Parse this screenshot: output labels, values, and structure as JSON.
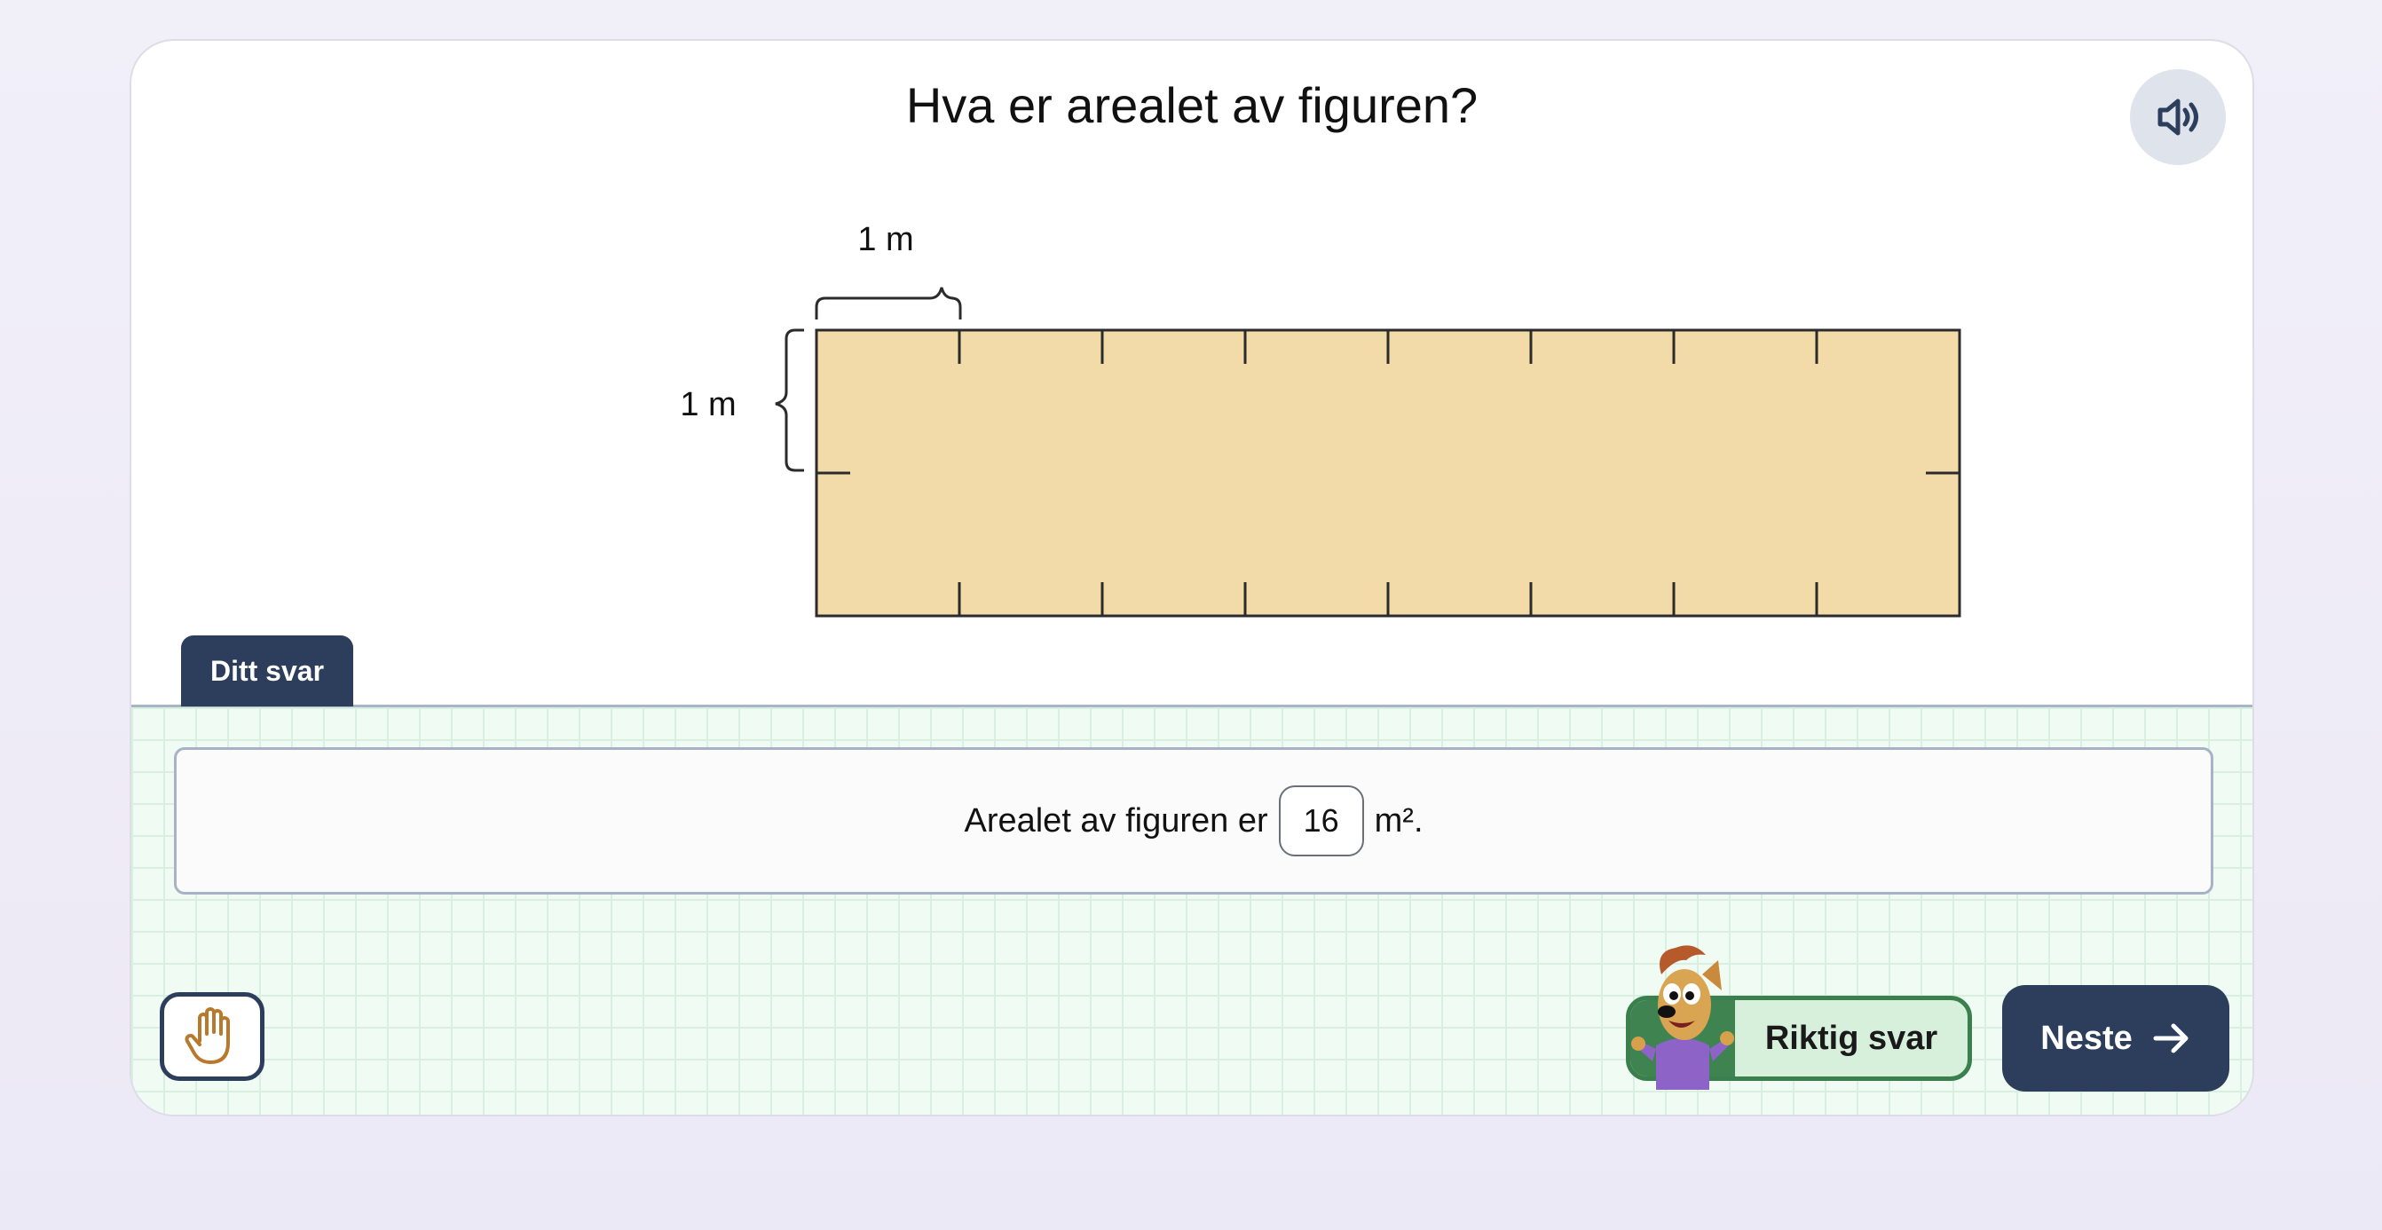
{
  "question": {
    "title": "Hva er arealet av figuren?",
    "sound_icon": "speaker-icon"
  },
  "figure": {
    "unit_label_top": "1 m",
    "unit_label_left": "1 m",
    "columns": 8,
    "rows": 2,
    "fill_color": "#f3dba9",
    "stroke_color": "#2b2b2b"
  },
  "answer": {
    "tab_label": "Ditt svar",
    "sentence_prefix": "Arealet av figuren er",
    "value": "16",
    "sentence_suffix": "m².",
    "hand_icon": "hand-icon"
  },
  "feedback": {
    "label": "Riktig svar",
    "accent_color": "#3f8350"
  },
  "navigation": {
    "next_label": "Neste",
    "next_icon": "arrow-right-icon"
  },
  "colors": {
    "primary": "#2d3e5c",
    "grid_background": "#f0fbf3"
  }
}
